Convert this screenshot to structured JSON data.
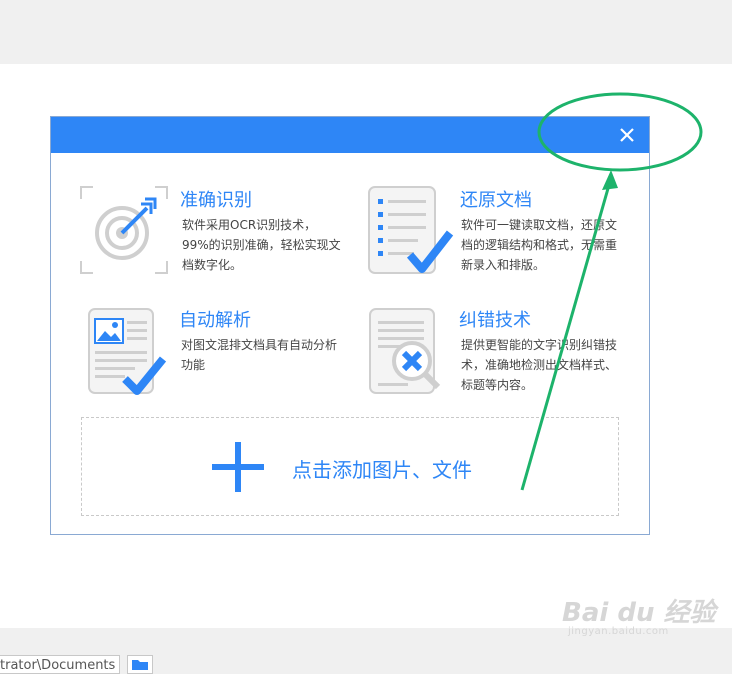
{
  "dialog": {
    "close_glyph": "✕",
    "accent_color": "#2e86f6",
    "features": [
      {
        "title": "准确识别",
        "desc": "软件采用OCR识别技术，99%的识别准确，轻松实现文档数字化。",
        "icon": "target-icon"
      },
      {
        "title": "还原文档",
        "desc": "软件可一键读取文档，还原文档的逻辑结构和格式，无需重新录入和排版。",
        "icon": "document-check-icon"
      },
      {
        "title": "自动解析",
        "desc": "对图文混排文档具有自动分析功能",
        "icon": "image-document-check-icon"
      },
      {
        "title": "纠错技术",
        "desc": "提供更智能的文字识别纠错技术，准确地检测出文档样式、标题等内容。",
        "icon": "document-magnifier-icon"
      }
    ],
    "add_files_label": "点击添加图片、文件"
  },
  "footer": {
    "path_value": "trator\\Documents"
  },
  "watermark": {
    "main": "Bai du 经验",
    "sub": "jingyan.baidu.com"
  },
  "annotation_color": "#1db36b"
}
